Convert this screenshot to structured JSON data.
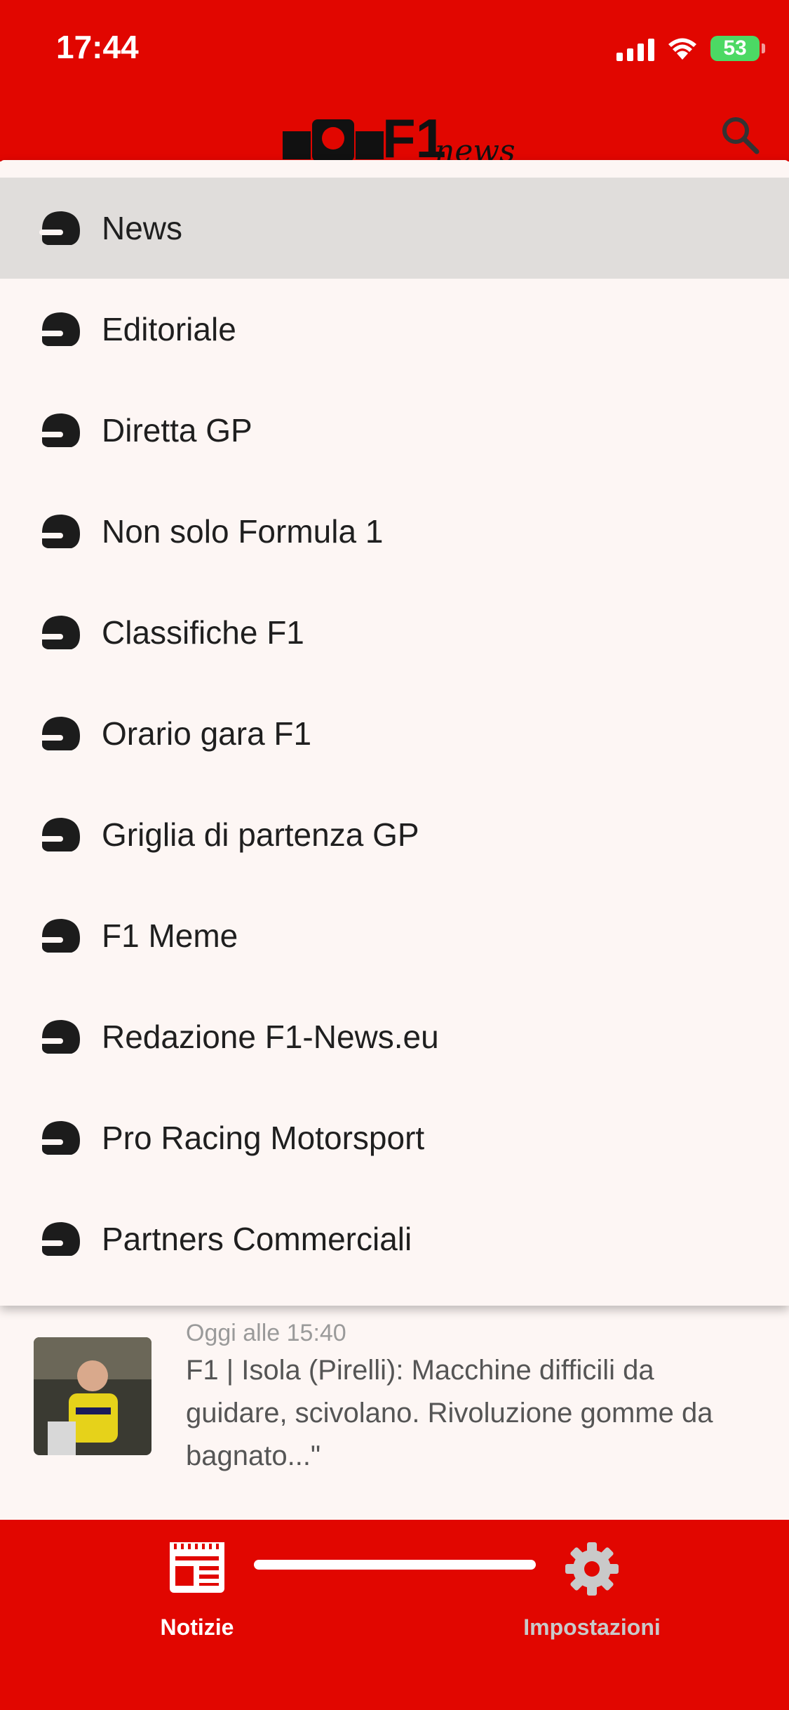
{
  "status_bar": {
    "time": "17:44",
    "battery": "53"
  },
  "header": {
    "logo_text": "F1 news"
  },
  "menu": {
    "items": [
      {
        "label": "News",
        "active": true
      },
      {
        "label": "Editoriale"
      },
      {
        "label": "Diretta GP"
      },
      {
        "label": "Non solo Formula 1"
      },
      {
        "label": "Classifiche F1"
      },
      {
        "label": "Orario gara F1"
      },
      {
        "label": "Griglia di partenza GP"
      },
      {
        "label": "F1 Meme"
      },
      {
        "label": "Redazione F1-News.eu"
      },
      {
        "label": "Pro Racing Motorsport"
      },
      {
        "label": "Partners Commerciali"
      }
    ]
  },
  "article": {
    "time": "Oggi alle 15:40",
    "title": "F1 | Isola (Pirelli): Macchine difficili da guidare, scivolano. Rivoluzione gomme da bagnato...\""
  },
  "tabbar": {
    "tabs": [
      {
        "label": "Notizie",
        "icon": "newspaper-icon",
        "active": true
      },
      {
        "label": "Impostazioni",
        "icon": "gear-icon",
        "active": false
      }
    ]
  },
  "colors": {
    "brand_red": "#e10600",
    "active_row": "#e0dddb",
    "menu_bg": "#fdf6f4",
    "inactive_tab": "#c9c9c9"
  }
}
